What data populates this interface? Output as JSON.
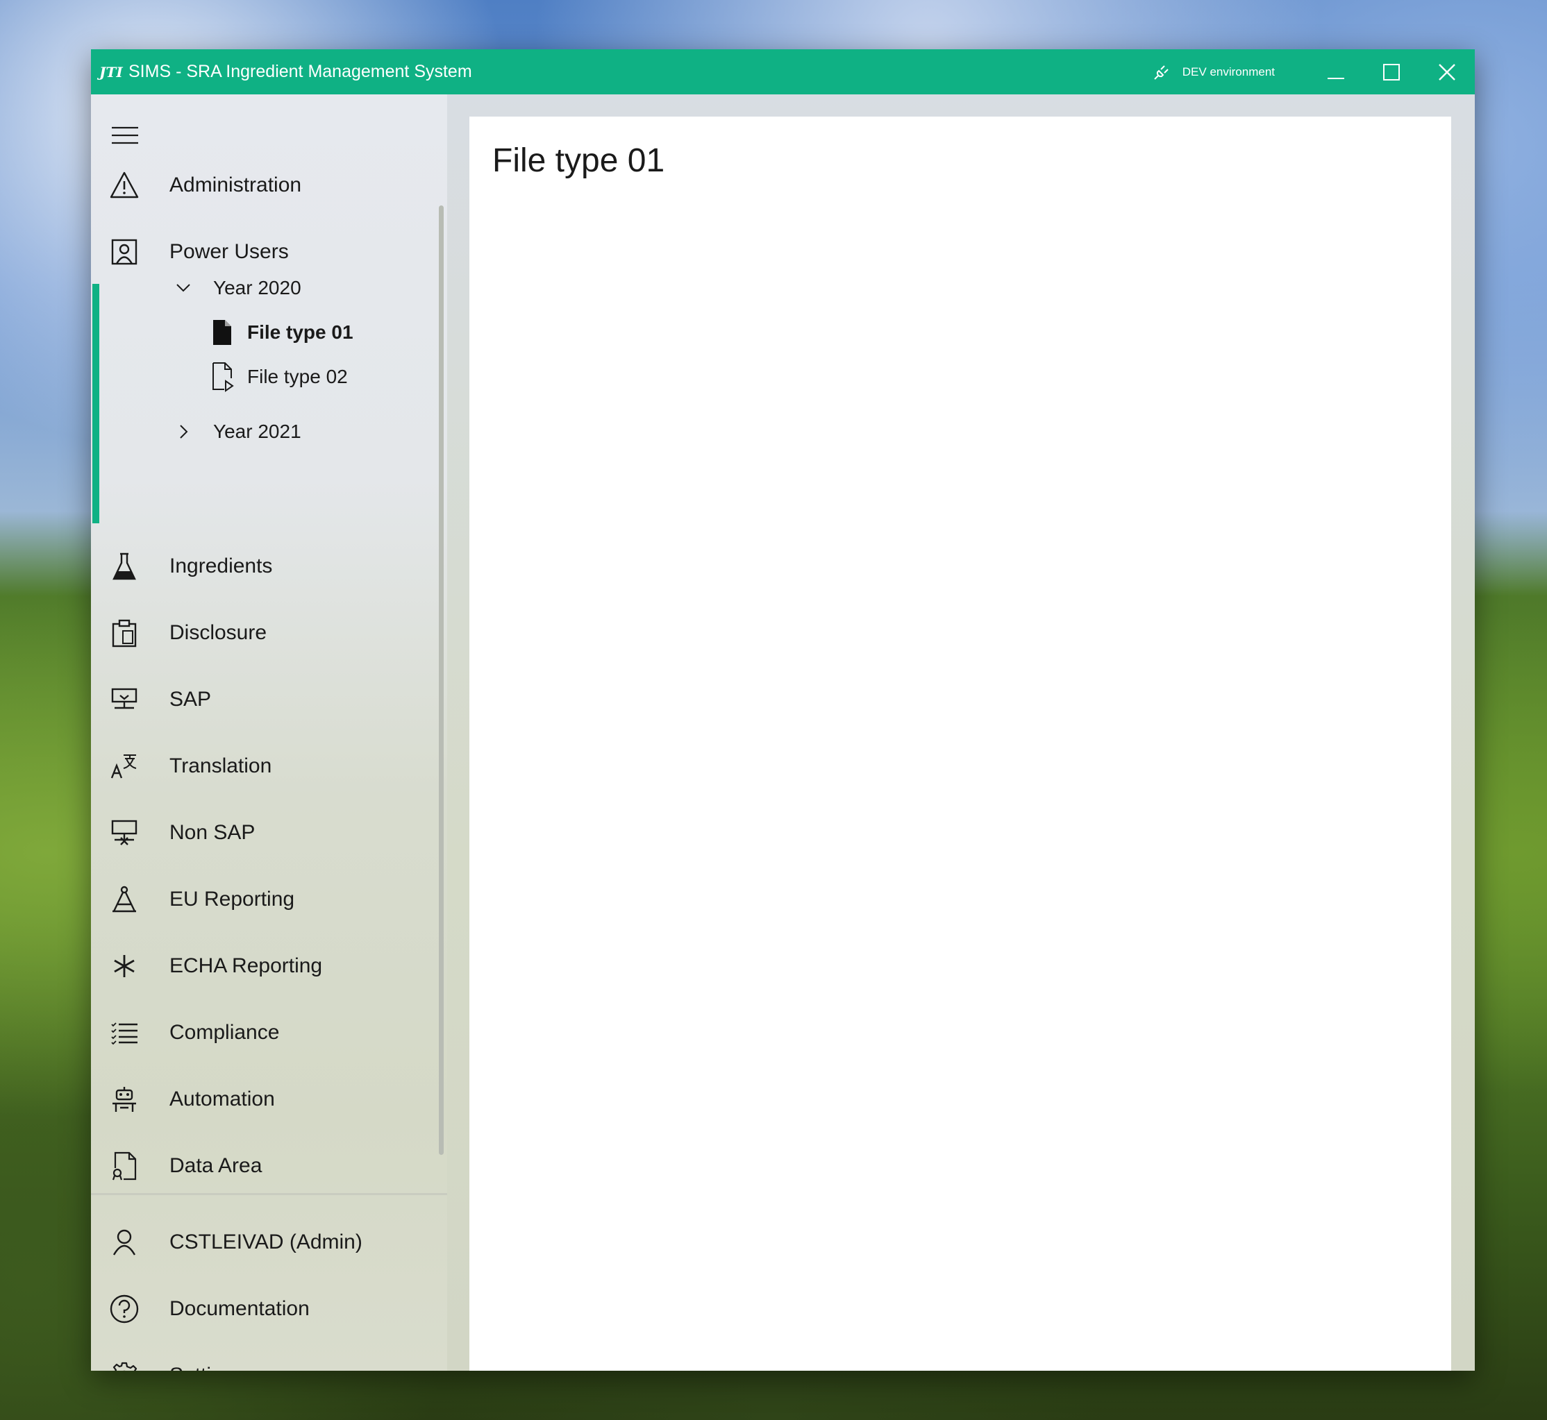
{
  "window": {
    "logo": "JTI",
    "title": "SIMS - SRA Ingredient Management System",
    "environment": "DEV environment"
  },
  "nav": {
    "administration": "Administration",
    "power_users": "Power Users",
    "year_2020": "Year 2020",
    "file_type_01": "File type 01",
    "file_type_02": "File type 02",
    "year_2021": "Year 2021",
    "ingredients": "Ingredients",
    "disclosure": "Disclosure",
    "sap": "SAP",
    "translation": "Translation",
    "non_sap": "Non SAP",
    "eu_reporting": "EU Reporting",
    "echa_reporting": "ECHA Reporting",
    "compliance": "Compliance",
    "automation": "Automation",
    "data_area": "Data Area"
  },
  "footer_nav": {
    "user": "CSTLEIVAD (Admin)",
    "documentation": "Documentation",
    "settings": "Settings"
  },
  "main": {
    "page_title": "File type 01"
  },
  "colors": {
    "accent": "#0fb184"
  }
}
